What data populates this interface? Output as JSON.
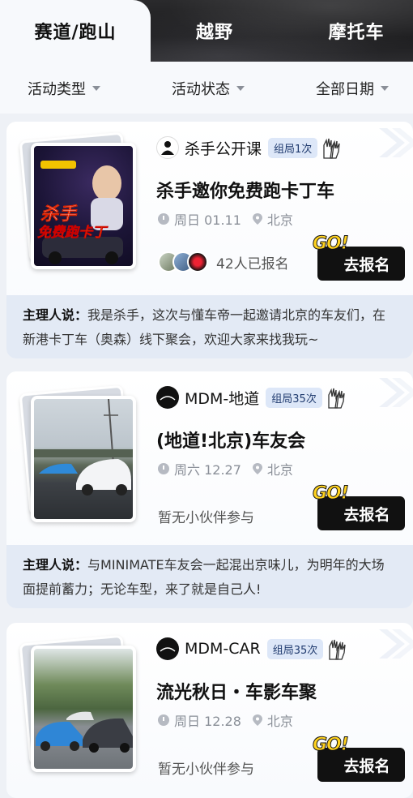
{
  "tabs": [
    {
      "label": "赛道/跑山",
      "active": true
    },
    {
      "label": "越野",
      "active": false
    },
    {
      "label": "摩托车",
      "active": false
    }
  ],
  "filters": [
    {
      "label": "活动类型"
    },
    {
      "label": "活动状态"
    },
    {
      "label": "全部日期"
    }
  ],
  "colors": {
    "accent_badge_bg": "#dde7f8",
    "go_yellow": "#ffd21f",
    "button_bg": "#111111"
  },
  "events": [
    {
      "organizer": "杀手公开课",
      "group_count": "组局1次",
      "title": "杀手邀你免费跑卡丁车",
      "day": "周日 01.11",
      "city": "北京",
      "signup_text": "42人已报名",
      "button_label": "去报名",
      "go_label": "GO!",
      "host_label": "主理人说：",
      "host_text": "我是杀手，这次与懂车帝一起邀请北京的车友们，在新港卡丁车（奥森）线下聚会，欢迎大家来找我玩~",
      "poster_text_1": "杀手",
      "poster_text_2": "免费跑卡丁"
    },
    {
      "organizer": "MDM-地道",
      "group_count": "组局35次",
      "title": "(地道!北京)车友会",
      "day": "周六 12.27",
      "city": "北京",
      "signup_text": "暂无小伙伴参与",
      "button_label": "去报名",
      "go_label": "GO!",
      "host_label": "主理人说：",
      "host_text": "与MINIMATE车友会一起混出京味儿，为明年的大场面提前蓄力；无论车型，来了就是自己人!"
    },
    {
      "organizer": "MDM-CAR",
      "group_count": "组局35次",
      "title": "流光秋日・车影车聚",
      "day": "周日 12.28",
      "city": "北京",
      "signup_text": "暂无小伙伴参与",
      "button_label": "去报名",
      "go_label": "GO!"
    }
  ]
}
